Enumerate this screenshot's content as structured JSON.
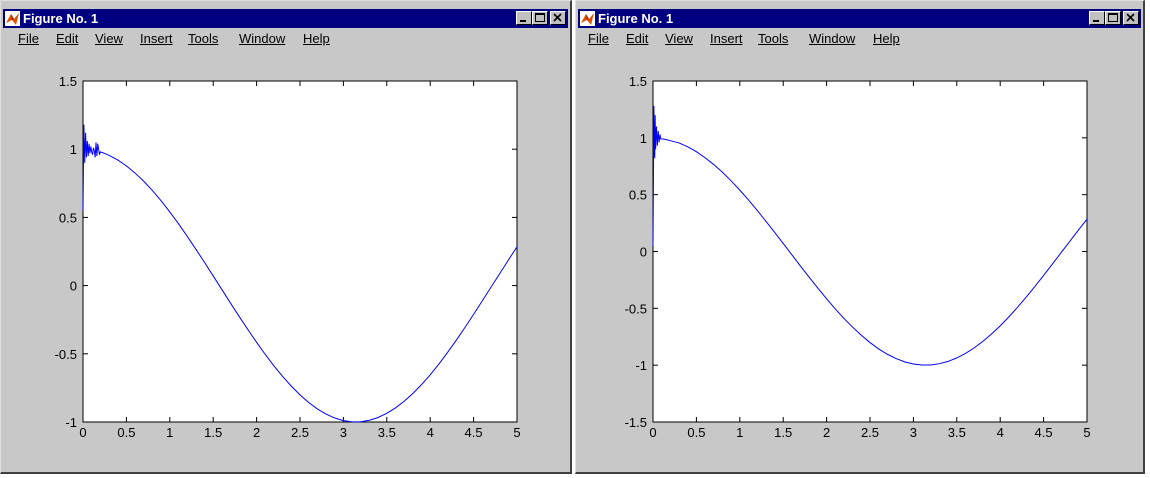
{
  "windows": [
    {
      "title": "Figure No. 1",
      "menu": [
        "File",
        "Edit",
        "View",
        "Insert",
        "Tools",
        "Window",
        "Help"
      ],
      "controls": [
        "minimize",
        "maximize",
        "close"
      ]
    },
    {
      "title": "Figure No. 1",
      "menu": [
        "File",
        "Edit",
        "View",
        "Insert",
        "Tools",
        "Window",
        "Help"
      ],
      "controls": [
        "minimize",
        "maximize",
        "close"
      ]
    }
  ],
  "colors": {
    "line": "#0000ff",
    "titlebar": "#000080",
    "window_bg": "#c8c8c8",
    "axes_bg": "#ffffff"
  },
  "chart_data": [
    {
      "type": "line",
      "xlim": [
        0,
        5
      ],
      "ylim": [
        -1,
        1.5
      ],
      "xticks": [
        "0",
        "0.5",
        "1",
        "1.5",
        "2",
        "2.5",
        "3",
        "3.5",
        "4",
        "4.5",
        "5"
      ],
      "yticks": [
        "-1",
        "-0.5",
        "0",
        "0.5",
        "1",
        "1.5"
      ],
      "grid": false,
      "series": [
        {
          "x": [
            0,
            0.005,
            0.01,
            0.015,
            0.02,
            0.03,
            0.04,
            0.05,
            0.06,
            0.07,
            0.08,
            0.09,
            0.1,
            0.11,
            0.12,
            0.13,
            0.14,
            0.15,
            0.16,
            0.17,
            0.18,
            0.19,
            0.2,
            0.22,
            0.25,
            0.3,
            0.4,
            0.5,
            0.6,
            0.7,
            0.8,
            0.9,
            1.0,
            1.1,
            1.2,
            1.3,
            1.4,
            1.5,
            1.6,
            1.7,
            1.8,
            1.9,
            2.0,
            2.1,
            2.2,
            2.3,
            2.4,
            2.5,
            2.6,
            2.7,
            2.8,
            2.9,
            3.0,
            3.1,
            3.2,
            3.3,
            3.4,
            3.5,
            3.6,
            3.7,
            3.8,
            3.9,
            4.0,
            4.1,
            4.2,
            4.3,
            4.4,
            4.5,
            4.6,
            4.7,
            4.8,
            4.9,
            5.0
          ],
          "y": [
            0.55,
            0.85,
            1.18,
            1.05,
            0.9,
            1.12,
            0.94,
            1.06,
            0.95,
            1.04,
            0.97,
            1.02,
            0.98,
            0.96,
            1.01,
            0.99,
            0.94,
            1.05,
            0.95,
            1.04,
            1.0,
            0.96,
            0.98,
            0.976,
            0.969,
            0.955,
            0.921,
            0.878,
            0.825,
            0.765,
            0.697,
            0.622,
            0.54,
            0.454,
            0.362,
            0.267,
            0.17,
            0.071,
            -0.029,
            -0.129,
            -0.227,
            -0.323,
            -0.416,
            -0.505,
            -0.589,
            -0.666,
            -0.737,
            -0.801,
            -0.857,
            -0.904,
            -0.942,
            -0.971,
            -0.99,
            -0.999,
            -0.998,
            -0.987,
            -0.967,
            -0.936,
            -0.897,
            -0.848,
            -0.791,
            -0.726,
            -0.654,
            -0.575,
            -0.49,
            -0.401,
            -0.307,
            -0.211,
            -0.112,
            -0.012,
            0.087,
            0.187,
            0.284
          ]
        }
      ]
    },
    {
      "type": "line",
      "xlim": [
        0,
        5
      ],
      "ylim": [
        -1.5,
        1.5
      ],
      "xticks": [
        "0",
        "0.5",
        "1",
        "1.5",
        "2",
        "2.5",
        "3",
        "3.5",
        "4",
        "4.5",
        "5"
      ],
      "yticks": [
        "-1.5",
        "-1",
        "-0.5",
        "0",
        "0.5",
        "1",
        "1.5"
      ],
      "grid": false,
      "series": [
        {
          "x": [
            0,
            0.005,
            0.01,
            0.015,
            0.02,
            0.025,
            0.03,
            0.04,
            0.05,
            0.06,
            0.07,
            0.08,
            0.09,
            0.1,
            0.12,
            0.15,
            0.2,
            0.3,
            0.4,
            0.5,
            0.6,
            0.7,
            0.8,
            0.9,
            1.0,
            1.1,
            1.2,
            1.3,
            1.4,
            1.5,
            1.6,
            1.7,
            1.8,
            1.9,
            2.0,
            2.1,
            2.2,
            2.3,
            2.4,
            2.5,
            2.6,
            2.7,
            2.8,
            2.9,
            3.0,
            3.1,
            3.2,
            3.3,
            3.4,
            3.5,
            3.6,
            3.7,
            3.8,
            3.9,
            4.0,
            4.1,
            4.2,
            4.3,
            4.4,
            4.5,
            4.6,
            4.7,
            4.8,
            4.9,
            5.0
          ],
          "y": [
            0.05,
            0.6,
            1.28,
            0.95,
            0.82,
            1.2,
            0.9,
            1.1,
            0.93,
            1.06,
            0.96,
            1.03,
            0.99,
            0.99,
            0.99,
            0.985,
            0.975,
            0.955,
            0.921,
            0.878,
            0.825,
            0.765,
            0.697,
            0.622,
            0.54,
            0.454,
            0.362,
            0.267,
            0.17,
            0.071,
            -0.029,
            -0.129,
            -0.227,
            -0.323,
            -0.416,
            -0.505,
            -0.589,
            -0.666,
            -0.737,
            -0.801,
            -0.857,
            -0.904,
            -0.942,
            -0.971,
            -0.99,
            -0.999,
            -0.998,
            -0.987,
            -0.967,
            -0.936,
            -0.897,
            -0.848,
            -0.791,
            -0.726,
            -0.654,
            -0.575,
            -0.49,
            -0.401,
            -0.307,
            -0.211,
            -0.112,
            -0.012,
            0.087,
            0.187,
            0.284
          ]
        }
      ]
    }
  ]
}
